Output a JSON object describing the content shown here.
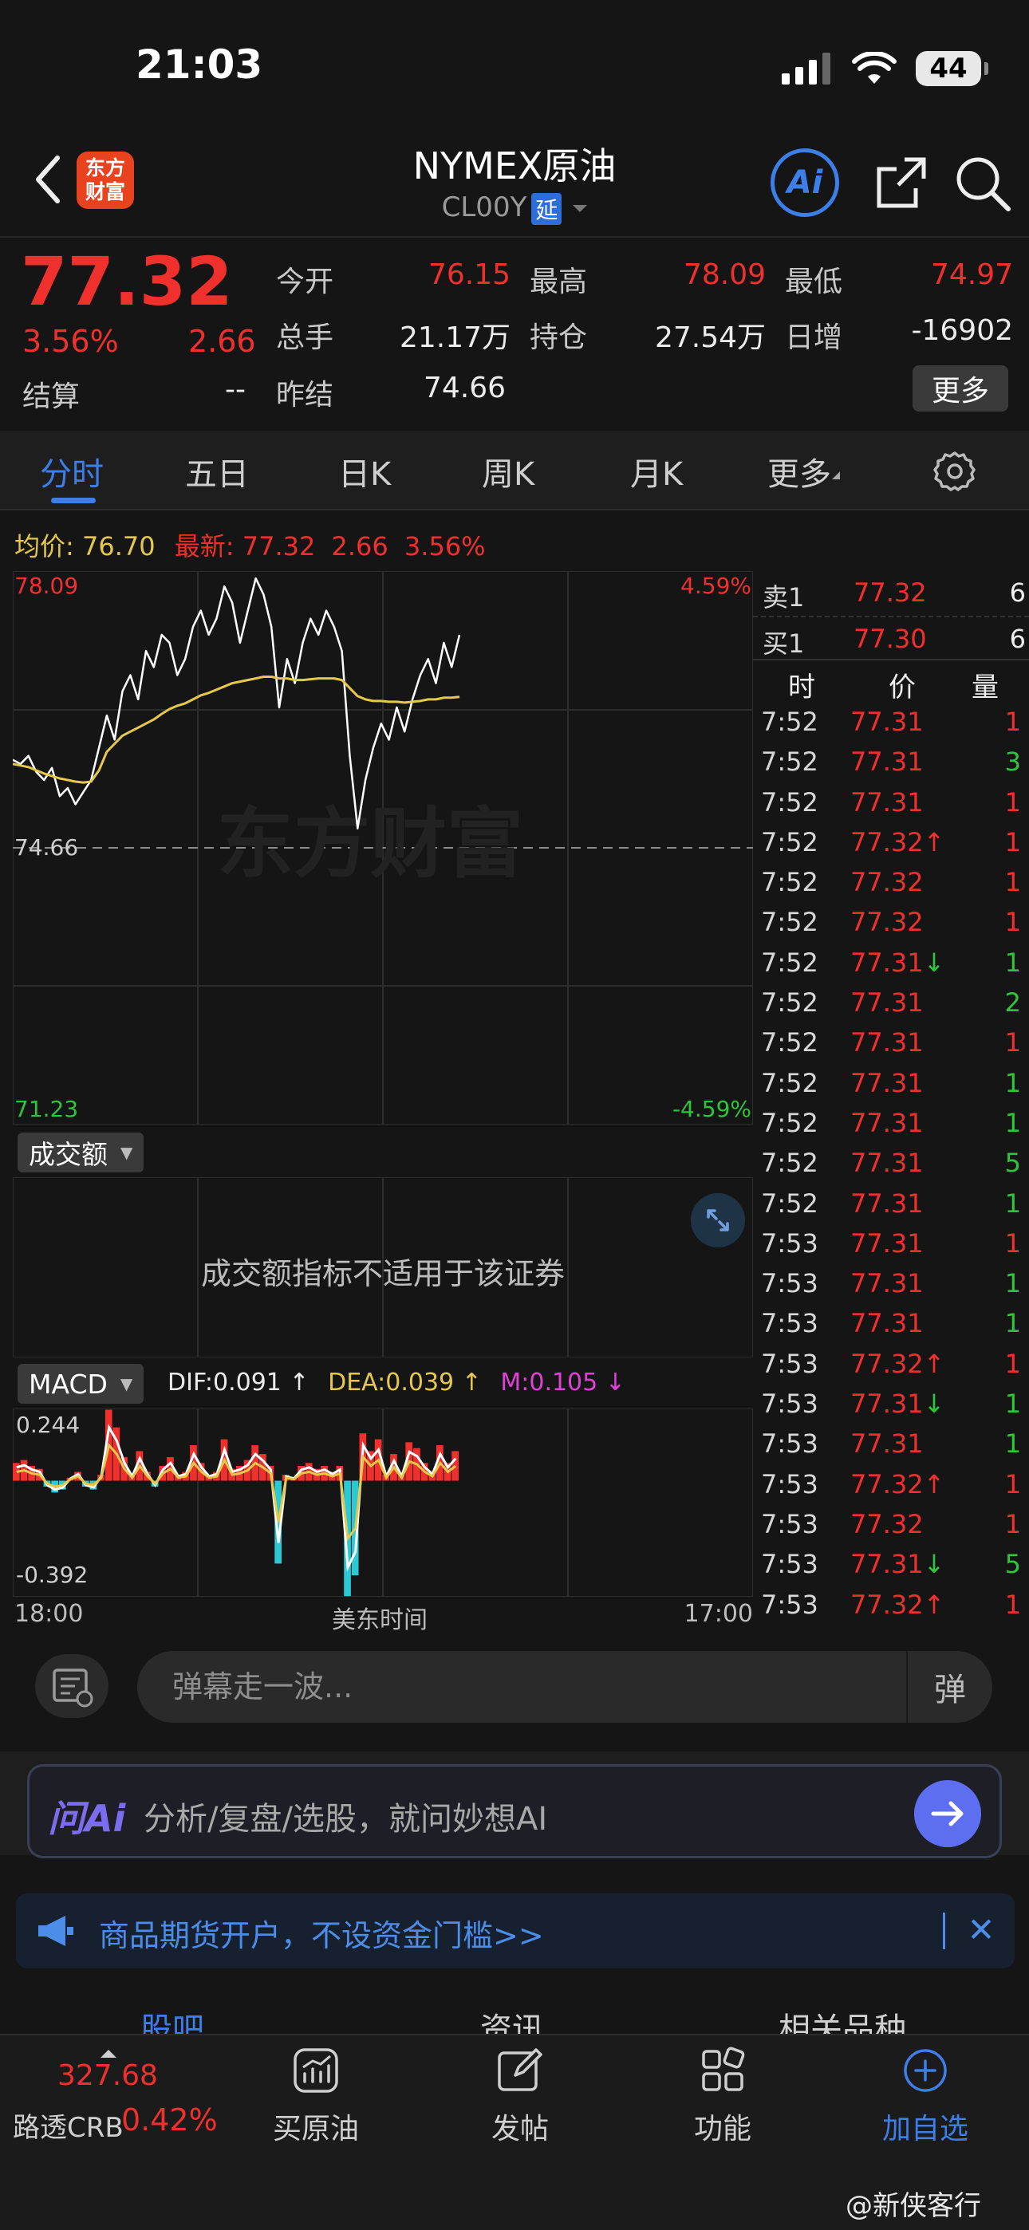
{
  "status": {
    "time": "21:03",
    "battery": "44"
  },
  "header": {
    "logo_line1": "东方",
    "logo_line2": "财富",
    "title": "NYMEX原油",
    "code": "CL00Y",
    "delay_badge": "延",
    "ai_label": "Ai"
  },
  "quote": {
    "last": "77.32",
    "pct": "3.56%",
    "chg": "2.66",
    "settle_label": "结算",
    "settle_value": "--",
    "fields": [
      {
        "label": "今开",
        "value": "76.15",
        "color": "red"
      },
      {
        "label": "最高",
        "value": "78.09",
        "color": "red"
      },
      {
        "label": "最低",
        "value": "74.97",
        "color": "red"
      },
      {
        "label": "总手",
        "value": "21.17万",
        "color": "white"
      },
      {
        "label": "持仓",
        "value": "27.54万",
        "color": "white"
      },
      {
        "label": "日增",
        "value": "-16902",
        "color": "white"
      },
      {
        "label": "昨结",
        "value": "74.66",
        "color": "white"
      }
    ],
    "more_label": "更多"
  },
  "tabs": [
    {
      "label": "分时",
      "active": true
    },
    {
      "label": "五日",
      "active": false
    },
    {
      "label": "日K",
      "active": false
    },
    {
      "label": "周K",
      "active": false
    },
    {
      "label": "月K",
      "active": false
    },
    {
      "label": "更多",
      "active": false
    }
  ],
  "legend": {
    "avg_label": "均价:",
    "avg_value": "76.70",
    "latest_label": "最新:",
    "latest_value": "77.32",
    "latest_chg": "2.66",
    "latest_pct": "3.56%"
  },
  "chart_data": [
    {
      "type": "line",
      "title": "",
      "x_start_label": "18:00",
      "x_mid_label": "美东时间",
      "x_end_label": "17:00",
      "ylim": [
        71.23,
        78.09
      ],
      "y_top_label": "78.09",
      "y_mid_label": "74.66",
      "y_bottom_label": "71.23",
      "pct_top_label": "4.59%",
      "pct_bottom_label": "-4.59%",
      "series": [
        {
          "values": [
            75.75,
            75.7,
            75.8,
            75.6,
            75.5,
            75.65,
            75.3,
            75.4,
            75.2,
            75.35,
            75.5,
            75.9,
            76.3,
            76.0,
            76.6,
            76.8,
            76.5,
            77.1,
            76.9,
            77.3,
            77.2,
            76.8,
            77.0,
            77.4,
            77.6,
            77.3,
            77.5,
            77.9,
            77.7,
            77.2,
            77.6,
            78.0,
            77.8,
            77.4,
            76.4,
            77.0,
            76.7,
            77.2,
            77.5,
            77.3,
            77.6,
            77.4,
            77.1,
            75.8,
            74.9,
            75.5,
            75.9,
            76.2,
            76.0,
            76.4,
            76.1,
            76.5,
            76.8,
            77.0,
            76.7,
            77.2,
            76.9,
            77.3
          ]
        },
        {
          "values": [
            75.7,
            75.68,
            75.66,
            75.62,
            75.58,
            75.55,
            75.52,
            75.5,
            75.48,
            75.47,
            75.48,
            75.62,
            75.85,
            75.95,
            76.05,
            76.1,
            76.15,
            76.2,
            76.25,
            76.32,
            76.38,
            76.42,
            76.45,
            76.5,
            76.55,
            76.58,
            76.62,
            76.66,
            76.7,
            76.72,
            76.74,
            76.76,
            76.78,
            76.78,
            76.76,
            76.76,
            76.74,
            76.74,
            76.75,
            76.76,
            76.76,
            76.76,
            76.74,
            76.64,
            76.54,
            76.5,
            76.48,
            76.48,
            76.47,
            76.47,
            76.46,
            76.47,
            76.48,
            76.5,
            76.5,
            76.52,
            76.52,
            76.53
          ]
        }
      ]
    },
    {
      "type": "bar",
      "title": "",
      "ylim": [
        -0.392,
        0.244
      ],
      "y_top_label": "0.244",
      "y_bottom_label": "-0.392",
      "series": [
        {
          "values": [
            0.06,
            0.07,
            0.05,
            0.04,
            -0.02,
            -0.04,
            -0.03,
            0.01,
            0.03,
            -0.02,
            -0.03,
            0.02,
            0.24,
            0.18,
            0.08,
            0.02,
            0.1,
            0.03,
            -0.02,
            0.05,
            0.08,
            0.02,
            0.03,
            0.12,
            0.06,
            0.02,
            0.03,
            0.14,
            0.04,
            0.05,
            0.07,
            0.12,
            0.09,
            0.05,
            -0.28,
            0.02,
            0.01,
            0.05,
            0.06,
            0.04,
            0.05,
            0.03,
            0.05,
            -0.39,
            -0.32,
            0.16,
            0.1,
            0.14,
            0.02,
            0.09,
            0.02,
            0.13,
            0.11,
            0.06,
            0.03,
            0.12,
            0.06,
            0.1
          ]
        }
      ]
    }
  ],
  "volume": {
    "button": "成交额",
    "message": "成交额指标不适用于该证券"
  },
  "macd": {
    "button": "MACD",
    "dif": "DIF:0.091 ↑",
    "dea": "DEA:0.039 ↑",
    "m": "M:0.105 ↓"
  },
  "orderbook": {
    "sell_label": "卖1",
    "sell_price": "77.32",
    "sell_vol": "6",
    "buy_label": "买1",
    "buy_price": "77.30",
    "buy_vol": "6"
  },
  "ticks": {
    "headers": [
      "时",
      "价",
      "量"
    ],
    "rows": [
      {
        "time": "7:52",
        "price": "77.31",
        "arrow": "",
        "vol": "1",
        "vcolor": "red"
      },
      {
        "time": "7:52",
        "price": "77.31",
        "arrow": "",
        "vol": "3",
        "vcolor": "green"
      },
      {
        "time": "7:52",
        "price": "77.31",
        "arrow": "",
        "vol": "1",
        "vcolor": "red"
      },
      {
        "time": "7:52",
        "price": "77.32",
        "arrow": "↑",
        "vol": "1",
        "vcolor": "red"
      },
      {
        "time": "7:52",
        "price": "77.32",
        "arrow": "",
        "vol": "1",
        "vcolor": "red"
      },
      {
        "time": "7:52",
        "price": "77.32",
        "arrow": "",
        "vol": "1",
        "vcolor": "red"
      },
      {
        "time": "7:52",
        "price": "77.31",
        "arrow": "↓",
        "vol": "1",
        "vcolor": "green"
      },
      {
        "time": "7:52",
        "price": "77.31",
        "arrow": "",
        "vol": "2",
        "vcolor": "green"
      },
      {
        "time": "7:52",
        "price": "77.31",
        "arrow": "",
        "vol": "1",
        "vcolor": "red"
      },
      {
        "time": "7:52",
        "price": "77.31",
        "arrow": "",
        "vol": "1",
        "vcolor": "green"
      },
      {
        "time": "7:52",
        "price": "77.31",
        "arrow": "",
        "vol": "1",
        "vcolor": "green"
      },
      {
        "time": "7:52",
        "price": "77.31",
        "arrow": "",
        "vol": "5",
        "vcolor": "green"
      },
      {
        "time": "7:52",
        "price": "77.31",
        "arrow": "",
        "vol": "1",
        "vcolor": "green"
      },
      {
        "time": "7:53",
        "price": "77.31",
        "arrow": "",
        "vol": "1",
        "vcolor": "red"
      },
      {
        "time": "7:53",
        "price": "77.31",
        "arrow": "",
        "vol": "1",
        "vcolor": "green"
      },
      {
        "time": "7:53",
        "price": "77.31",
        "arrow": "",
        "vol": "1",
        "vcolor": "green"
      },
      {
        "time": "7:53",
        "price": "77.32",
        "arrow": "↑",
        "vol": "1",
        "vcolor": "red"
      },
      {
        "time": "7:53",
        "price": "77.31",
        "arrow": "↓",
        "vol": "1",
        "vcolor": "green"
      },
      {
        "time": "7:53",
        "price": "77.31",
        "arrow": "",
        "vol": "1",
        "vcolor": "green"
      },
      {
        "time": "7:53",
        "price": "77.32",
        "arrow": "↑",
        "vol": "1",
        "vcolor": "red"
      },
      {
        "time": "7:53",
        "price": "77.32",
        "arrow": "",
        "vol": "1",
        "vcolor": "red"
      },
      {
        "time": "7:53",
        "price": "77.31",
        "arrow": "↓",
        "vol": "5",
        "vcolor": "green"
      },
      {
        "time": "7:53",
        "price": "77.32",
        "arrow": "↑",
        "vol": "1",
        "vcolor": "red"
      }
    ]
  },
  "danmaku": {
    "placeholder": "弹幕走一波...",
    "switch_label": "弹"
  },
  "ai_bar": {
    "logo": "问Ai",
    "text": "分析/复盘/选股，就问妙想AI"
  },
  "promo": {
    "text": "商品期货开户，不设资金门槛>>"
  },
  "sections": [
    "股吧",
    "资讯",
    "相关品种"
  ],
  "bottom_nav": {
    "ticker_value": "327.68",
    "ticker_name": "路透CRB",
    "ticker_pct": "0.42%",
    "items": [
      "买原油",
      "发帖",
      "功能",
      "加自选"
    ]
  },
  "watermark": "@新侠客行",
  "colors": {
    "up": "#f0302c",
    "down": "#2fc53a",
    "accent": "#3c7fe9",
    "avg_line": "#e6c84a"
  }
}
